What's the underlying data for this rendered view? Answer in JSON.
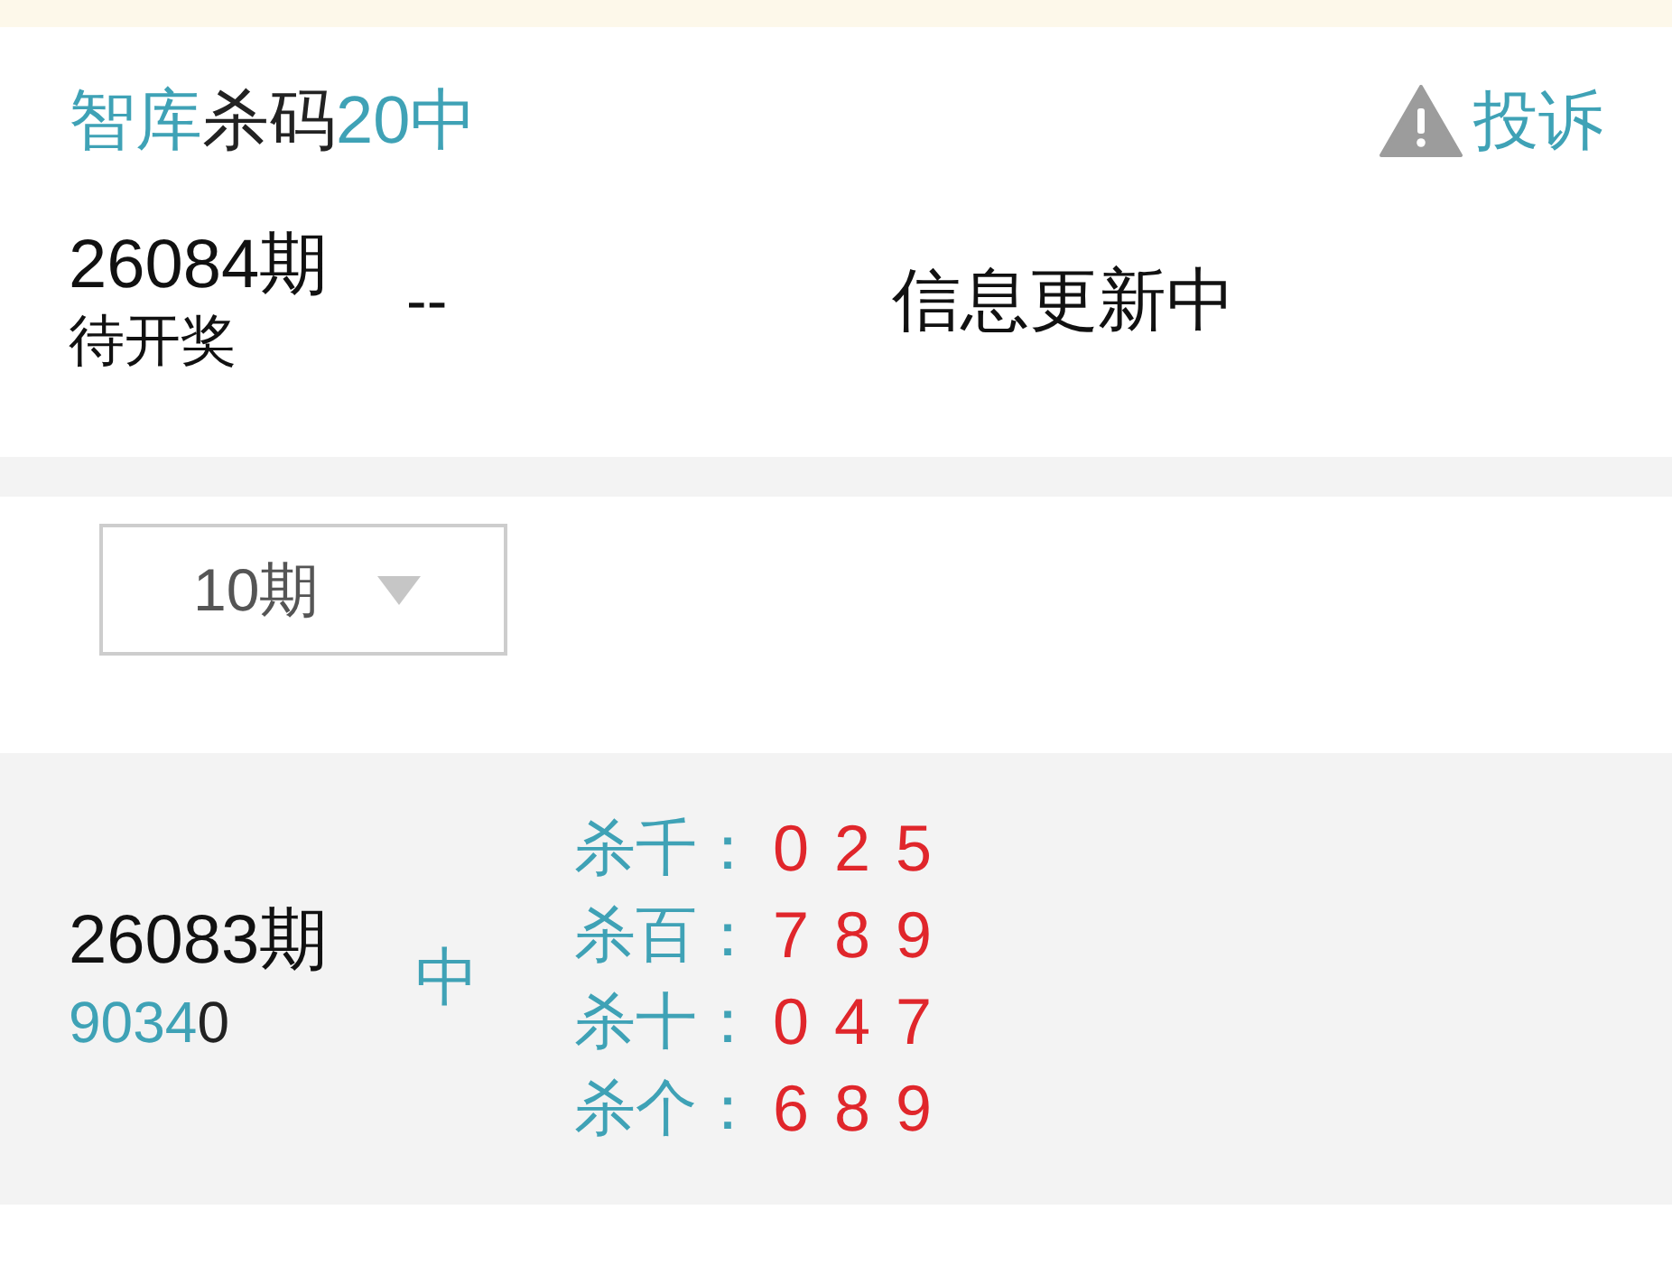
{
  "header": {
    "title": [
      {
        "text": "智库",
        "accent": true
      },
      {
        "text": "杀码",
        "accent": false
      },
      {
        "text": "20中",
        "accent": true
      }
    ],
    "complaint_button": {
      "label": "投诉"
    }
  },
  "current_issue": {
    "issue": "26084期",
    "status": "待开奖",
    "number": "--",
    "message": "信息更新中"
  },
  "filter": {
    "period_select": {
      "value": "10期"
    }
  },
  "results": [
    {
      "issue": "26083期",
      "digits": [
        {
          "text": "9",
          "hit": true
        },
        {
          "text": "0",
          "hit": true
        },
        {
          "text": "3",
          "hit": true
        },
        {
          "text": "4",
          "hit": true
        },
        {
          "text": "0",
          "hit": false
        }
      ],
      "outcome": "中",
      "kills": [
        {
          "label": "杀千：",
          "numbers": "0 2 5"
        },
        {
          "label": "杀百：",
          "numbers": "7 8 9"
        },
        {
          "label": "杀十：",
          "numbers": "0 4 7"
        },
        {
          "label": "杀个：",
          "numbers": "6 8 9"
        }
      ]
    }
  ]
}
